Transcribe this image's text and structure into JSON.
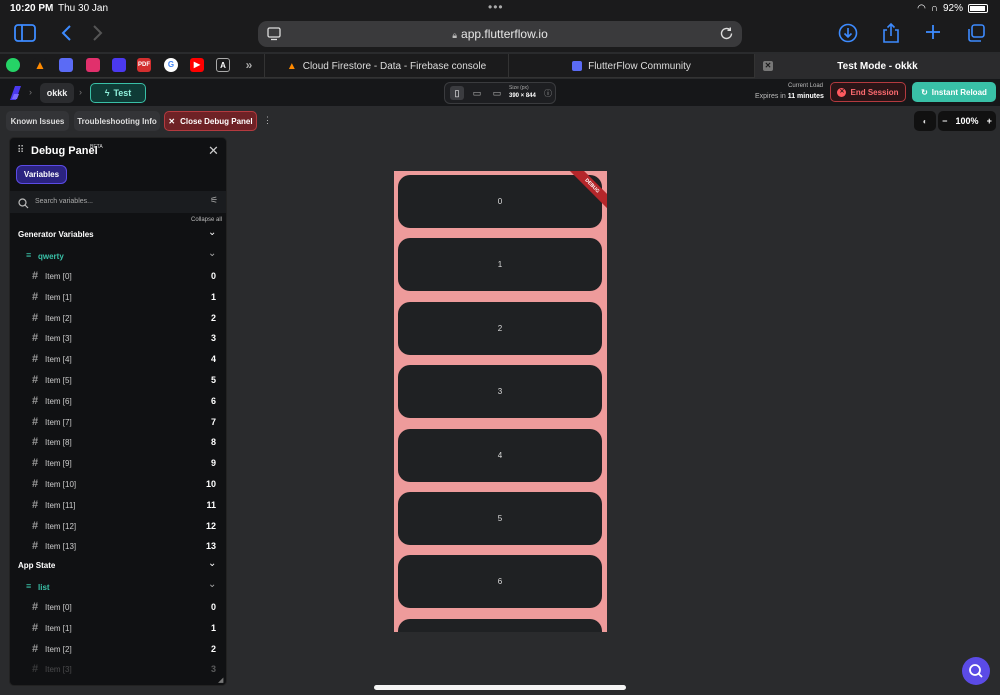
{
  "status_bar": {
    "time": "10:20 PM",
    "date": "Thu 30 Jan",
    "battery": "92%",
    "battery_level": 0.92
  },
  "browser": {
    "url": "app.flutterflow.io"
  },
  "tabs": [
    {
      "label": "Cloud Firestore - Data - Firebase console",
      "icon": "firebase-icon"
    },
    {
      "label": "FlutterFlow Community",
      "icon": "flutterflow-icon"
    },
    {
      "label": "Test Mode - okkk",
      "icon": "close-icon",
      "active": true
    }
  ],
  "favorites": [
    "WA",
    "F",
    "FF",
    "IG",
    "FF",
    "PDF",
    "G",
    "YT",
    "A"
  ],
  "header": {
    "project": "okkk",
    "mode": "Test",
    "size_label": "Size (px)",
    "size_value": "390 × 844",
    "current_load": "Current Load",
    "expires_prefix": "Expires in",
    "expires_value": "11 minutes",
    "end_session": "End Session",
    "instant_reload": "Instant Reload"
  },
  "subbar": {
    "known_issues": "Known Issues",
    "troubleshooting": "Troubleshooting Info",
    "close_debug": "Close Debug Panel",
    "zoom": "100%"
  },
  "debug_panel": {
    "title": "Debug Panel",
    "beta": "BETA",
    "variables_tab": "Variables",
    "search_placeholder": "Search variables...",
    "collapse_all": "Collapse all",
    "generator_section": "Generator Variables",
    "generator_var": "qwerty",
    "generator_items": [
      {
        "name": "Item [0]",
        "value": "0"
      },
      {
        "name": "Item [1]",
        "value": "1"
      },
      {
        "name": "Item [2]",
        "value": "2"
      },
      {
        "name": "Item [3]",
        "value": "3"
      },
      {
        "name": "Item [4]",
        "value": "4"
      },
      {
        "name": "Item [5]",
        "value": "5"
      },
      {
        "name": "Item [6]",
        "value": "6"
      },
      {
        "name": "Item [7]",
        "value": "7"
      },
      {
        "name": "Item [8]",
        "value": "8"
      },
      {
        "name": "Item [9]",
        "value": "9"
      },
      {
        "name": "Item [10]",
        "value": "10"
      },
      {
        "name": "Item [11]",
        "value": "11"
      },
      {
        "name": "Item [12]",
        "value": "12"
      },
      {
        "name": "Item [13]",
        "value": "13"
      }
    ],
    "app_state_section": "App State",
    "app_state_var": "list",
    "app_state_items": [
      {
        "name": "Item [0]",
        "value": "0"
      },
      {
        "name": "Item [1]",
        "value": "1"
      },
      {
        "name": "Item [2]",
        "value": "2"
      },
      {
        "name": "Item [3]",
        "value": "3"
      }
    ]
  },
  "preview": {
    "debug_ribbon": "DEBUG",
    "cards": [
      "0",
      "1",
      "2",
      "3",
      "4",
      "5",
      "6",
      ""
    ]
  }
}
